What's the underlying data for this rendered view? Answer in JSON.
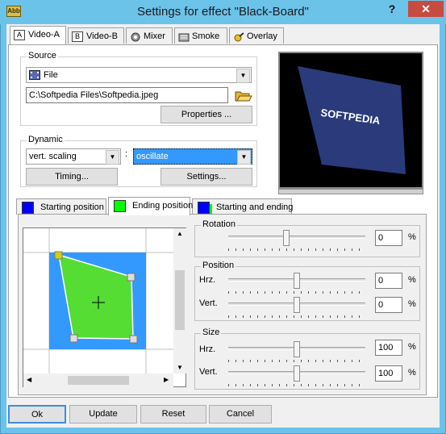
{
  "window": {
    "title": "Settings for effect \"Black-Board\"",
    "app_icon_text": "Abb",
    "help_label": "?",
    "close_label": "✕"
  },
  "top_tabs": [
    {
      "label": "Video-A",
      "icon": "A",
      "active": true
    },
    {
      "label": "Video-B",
      "icon": "B",
      "active": false
    },
    {
      "label": "Mixer",
      "icon": "mixer-icon",
      "active": false
    },
    {
      "label": "Smoke",
      "icon": "smoke-icon",
      "active": false
    },
    {
      "label": "Overlay",
      "icon": "overlay-icon",
      "active": false
    }
  ],
  "source": {
    "group_label": "Source",
    "type_value": "File",
    "path_value": "C:\\Softpedia Files\\Softpedia.jpeg",
    "properties_label": "Properties ..."
  },
  "dynamic": {
    "group_label": "Dynamic",
    "mode_value": "vert. scaling",
    "separator": ":",
    "function_value": "oscillate",
    "timing_label": "Timing...",
    "settings_label": "Settings..."
  },
  "preview": {
    "text": "SOFTPEDIA"
  },
  "position_tabs": [
    {
      "label": "Starting position",
      "color": "#0000ff",
      "active": false
    },
    {
      "label": "Ending position",
      "color": "#00ff00",
      "active": true
    },
    {
      "label": "Starting and ending",
      "color": "#0000ff",
      "active": false
    }
  ],
  "rotation": {
    "group_label": "Rotation",
    "value": "0",
    "unit": "%",
    "level": 0.5
  },
  "position": {
    "group_label": "Position",
    "hrz_label": "Hrz.",
    "hrz_value": "0",
    "vert_label": "Vert.",
    "vert_value": "0",
    "unit": "%"
  },
  "size": {
    "group_label": "Size",
    "hrz_label": "Hrz.",
    "hrz_value": "100",
    "vert_label": "Vert.",
    "vert_value": "100",
    "unit": "%"
  },
  "buttons": {
    "ok": "Ok",
    "update": "Update",
    "reset": "Reset",
    "cancel": "Cancel"
  },
  "colors": {
    "titlebar": "#6cc3ea",
    "close": "#c74b3f",
    "canvas_blue": "#3399ff",
    "shape_green": "#55dd33",
    "combo_highlight": "#3399ff"
  }
}
